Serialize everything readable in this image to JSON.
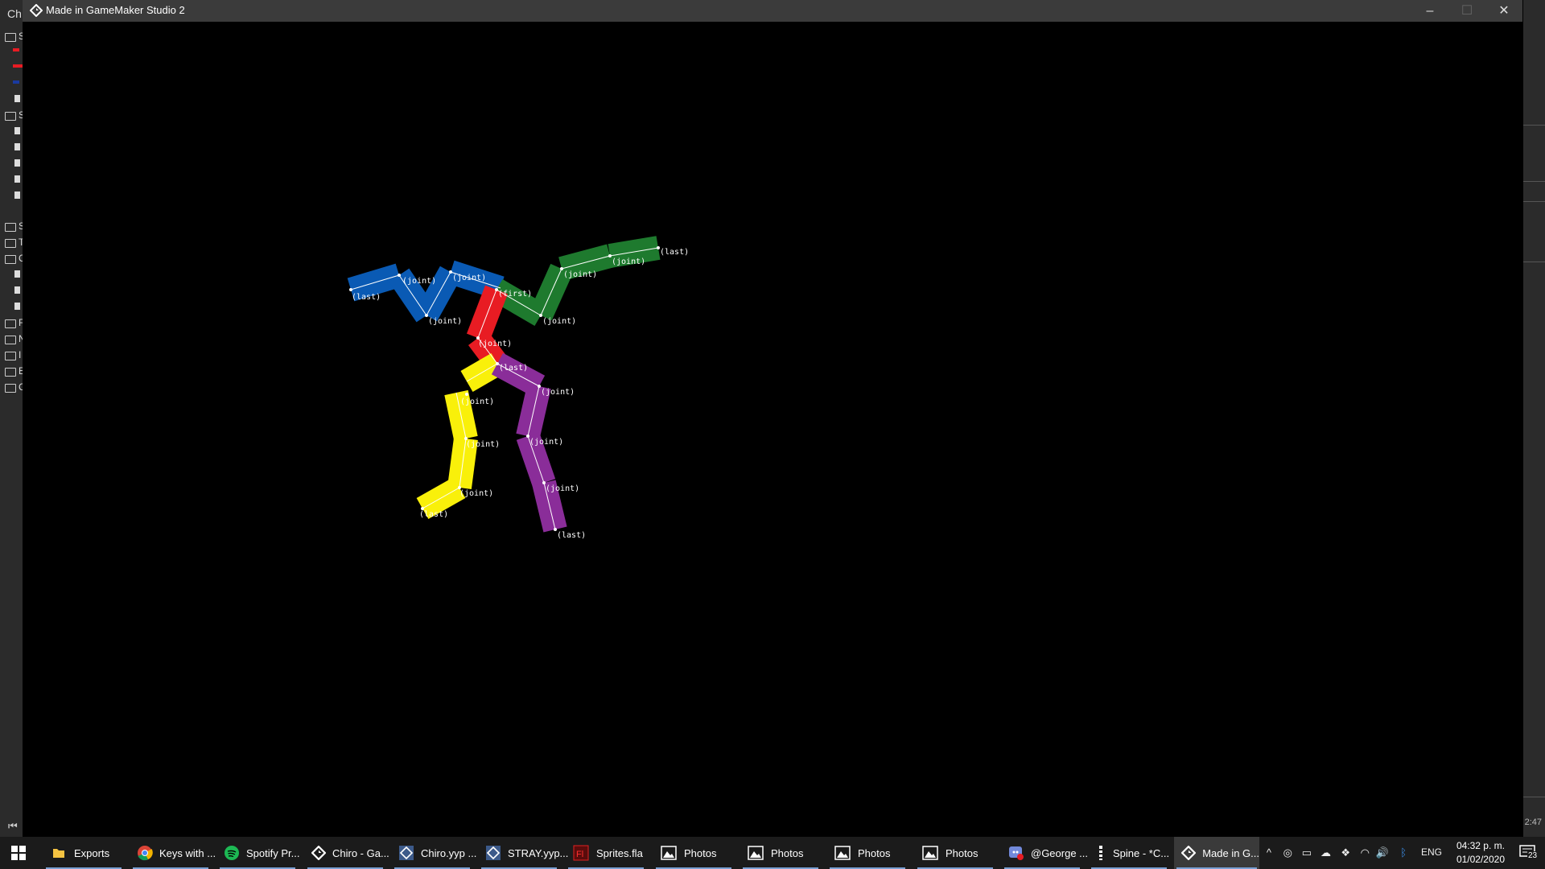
{
  "window": {
    "title": "Made in GameMaker Studio 2",
    "minimize": "–",
    "maximize": "☐",
    "close": "✕"
  },
  "ide": {
    "header_text": "Ch",
    "letters": [
      "S",
      "S",
      "S",
      "T",
      "C",
      "F",
      "N",
      "I",
      "E",
      "C"
    ],
    "time_fragment": "2:47"
  },
  "skeleton": {
    "colors": {
      "blue": "#0a5ab4",
      "green": "#1e7a2e",
      "red": "#e81c23",
      "yellow": "#f9f00a",
      "purple": "#8a2d99"
    },
    "labels": {
      "first": "(first)",
      "joint": "(joint)",
      "last": "(last)"
    }
  },
  "taskbar": {
    "apps": [
      {
        "label": "Exports",
        "icon": "folder-icon"
      },
      {
        "label": "Keys with ...",
        "icon": "chrome-icon"
      },
      {
        "label": "Spotify Pr...",
        "icon": "spotify-icon"
      },
      {
        "label": "Chiro - Ga...",
        "icon": "gamemaker-icon"
      },
      {
        "label": "Chiro.yyp ...",
        "icon": "gamemaker-project-icon"
      },
      {
        "label": "STRAY.yyp...",
        "icon": "gamemaker-project-icon"
      },
      {
        "label": "Sprites.fla",
        "icon": "flash-icon"
      },
      {
        "label": "Photos",
        "icon": "photos-icon"
      },
      {
        "label": "Photos",
        "icon": "photos-icon"
      },
      {
        "label": "Photos",
        "icon": "photos-icon"
      },
      {
        "label": "Photos",
        "icon": "photos-icon"
      },
      {
        "label": "@George ...",
        "icon": "discord-icon"
      },
      {
        "label": "Spine - *C...",
        "icon": "spine-icon"
      },
      {
        "label": "Made in G...",
        "icon": "gamemaker-icon"
      }
    ],
    "language": "ENG",
    "time": "04:32 p. m.",
    "date": "01/02/2020",
    "notifications": "23"
  }
}
